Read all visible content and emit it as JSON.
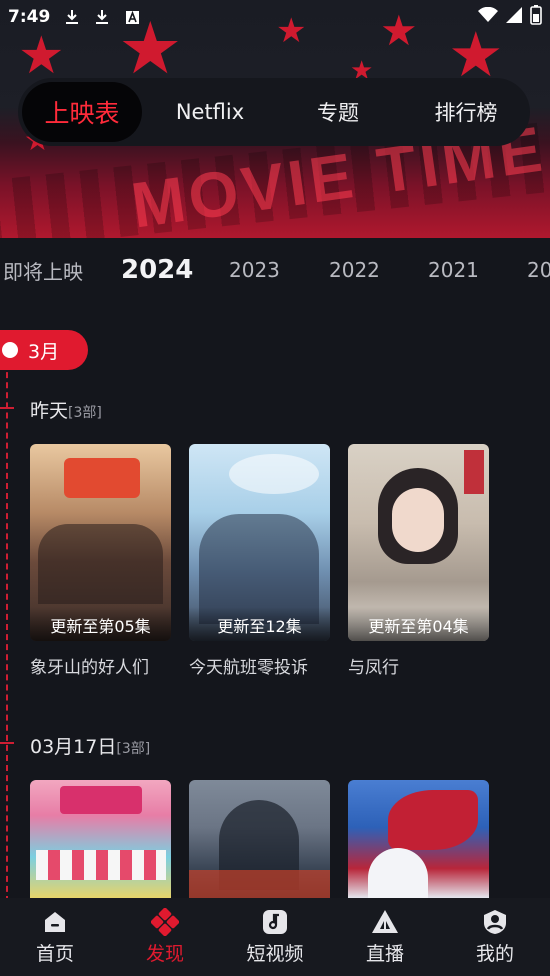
{
  "status_bar": {
    "time": "7:49"
  },
  "top_tabs": [
    {
      "label": "上映表",
      "active": true
    },
    {
      "label": "Netflix",
      "active": false
    },
    {
      "label": "专题",
      "active": false
    },
    {
      "label": "排行榜",
      "active": false
    }
  ],
  "banner": {
    "text": "MOVIE TIME"
  },
  "years": [
    {
      "label": "即将上映",
      "selected": false
    },
    {
      "label": "2024",
      "selected": true
    },
    {
      "label": "2023",
      "selected": false
    },
    {
      "label": "2022",
      "selected": false
    },
    {
      "label": "2021",
      "selected": false
    },
    {
      "label": "20",
      "selected": false
    }
  ],
  "month": {
    "label": "3月"
  },
  "groups": [
    {
      "title": "昨天",
      "count": "[3部]",
      "cards": [
        {
          "title": "象牙山的好人们",
          "badge": "更新至第05集"
        },
        {
          "title": "今天航班零投诉",
          "badge": "更新至12集"
        },
        {
          "title": "与凤行",
          "badge": "更新至第04集"
        }
      ]
    },
    {
      "title": "03月17日",
      "count": "[3部]",
      "cards": [
        {
          "title": "",
          "badge": ""
        },
        {
          "title": "",
          "badge": ""
        },
        {
          "title": "",
          "badge": ""
        }
      ]
    }
  ],
  "bottom_nav": [
    {
      "label": "首页",
      "icon": "home-icon",
      "active": false
    },
    {
      "label": "发现",
      "icon": "discover-icon",
      "active": true
    },
    {
      "label": "短视频",
      "icon": "short-video-icon",
      "active": false
    },
    {
      "label": "直播",
      "icon": "live-icon",
      "active": false
    },
    {
      "label": "我的",
      "icon": "profile-icon",
      "active": false
    }
  ],
  "colors": {
    "accent": "#e01a2f",
    "background": "#14161c"
  }
}
